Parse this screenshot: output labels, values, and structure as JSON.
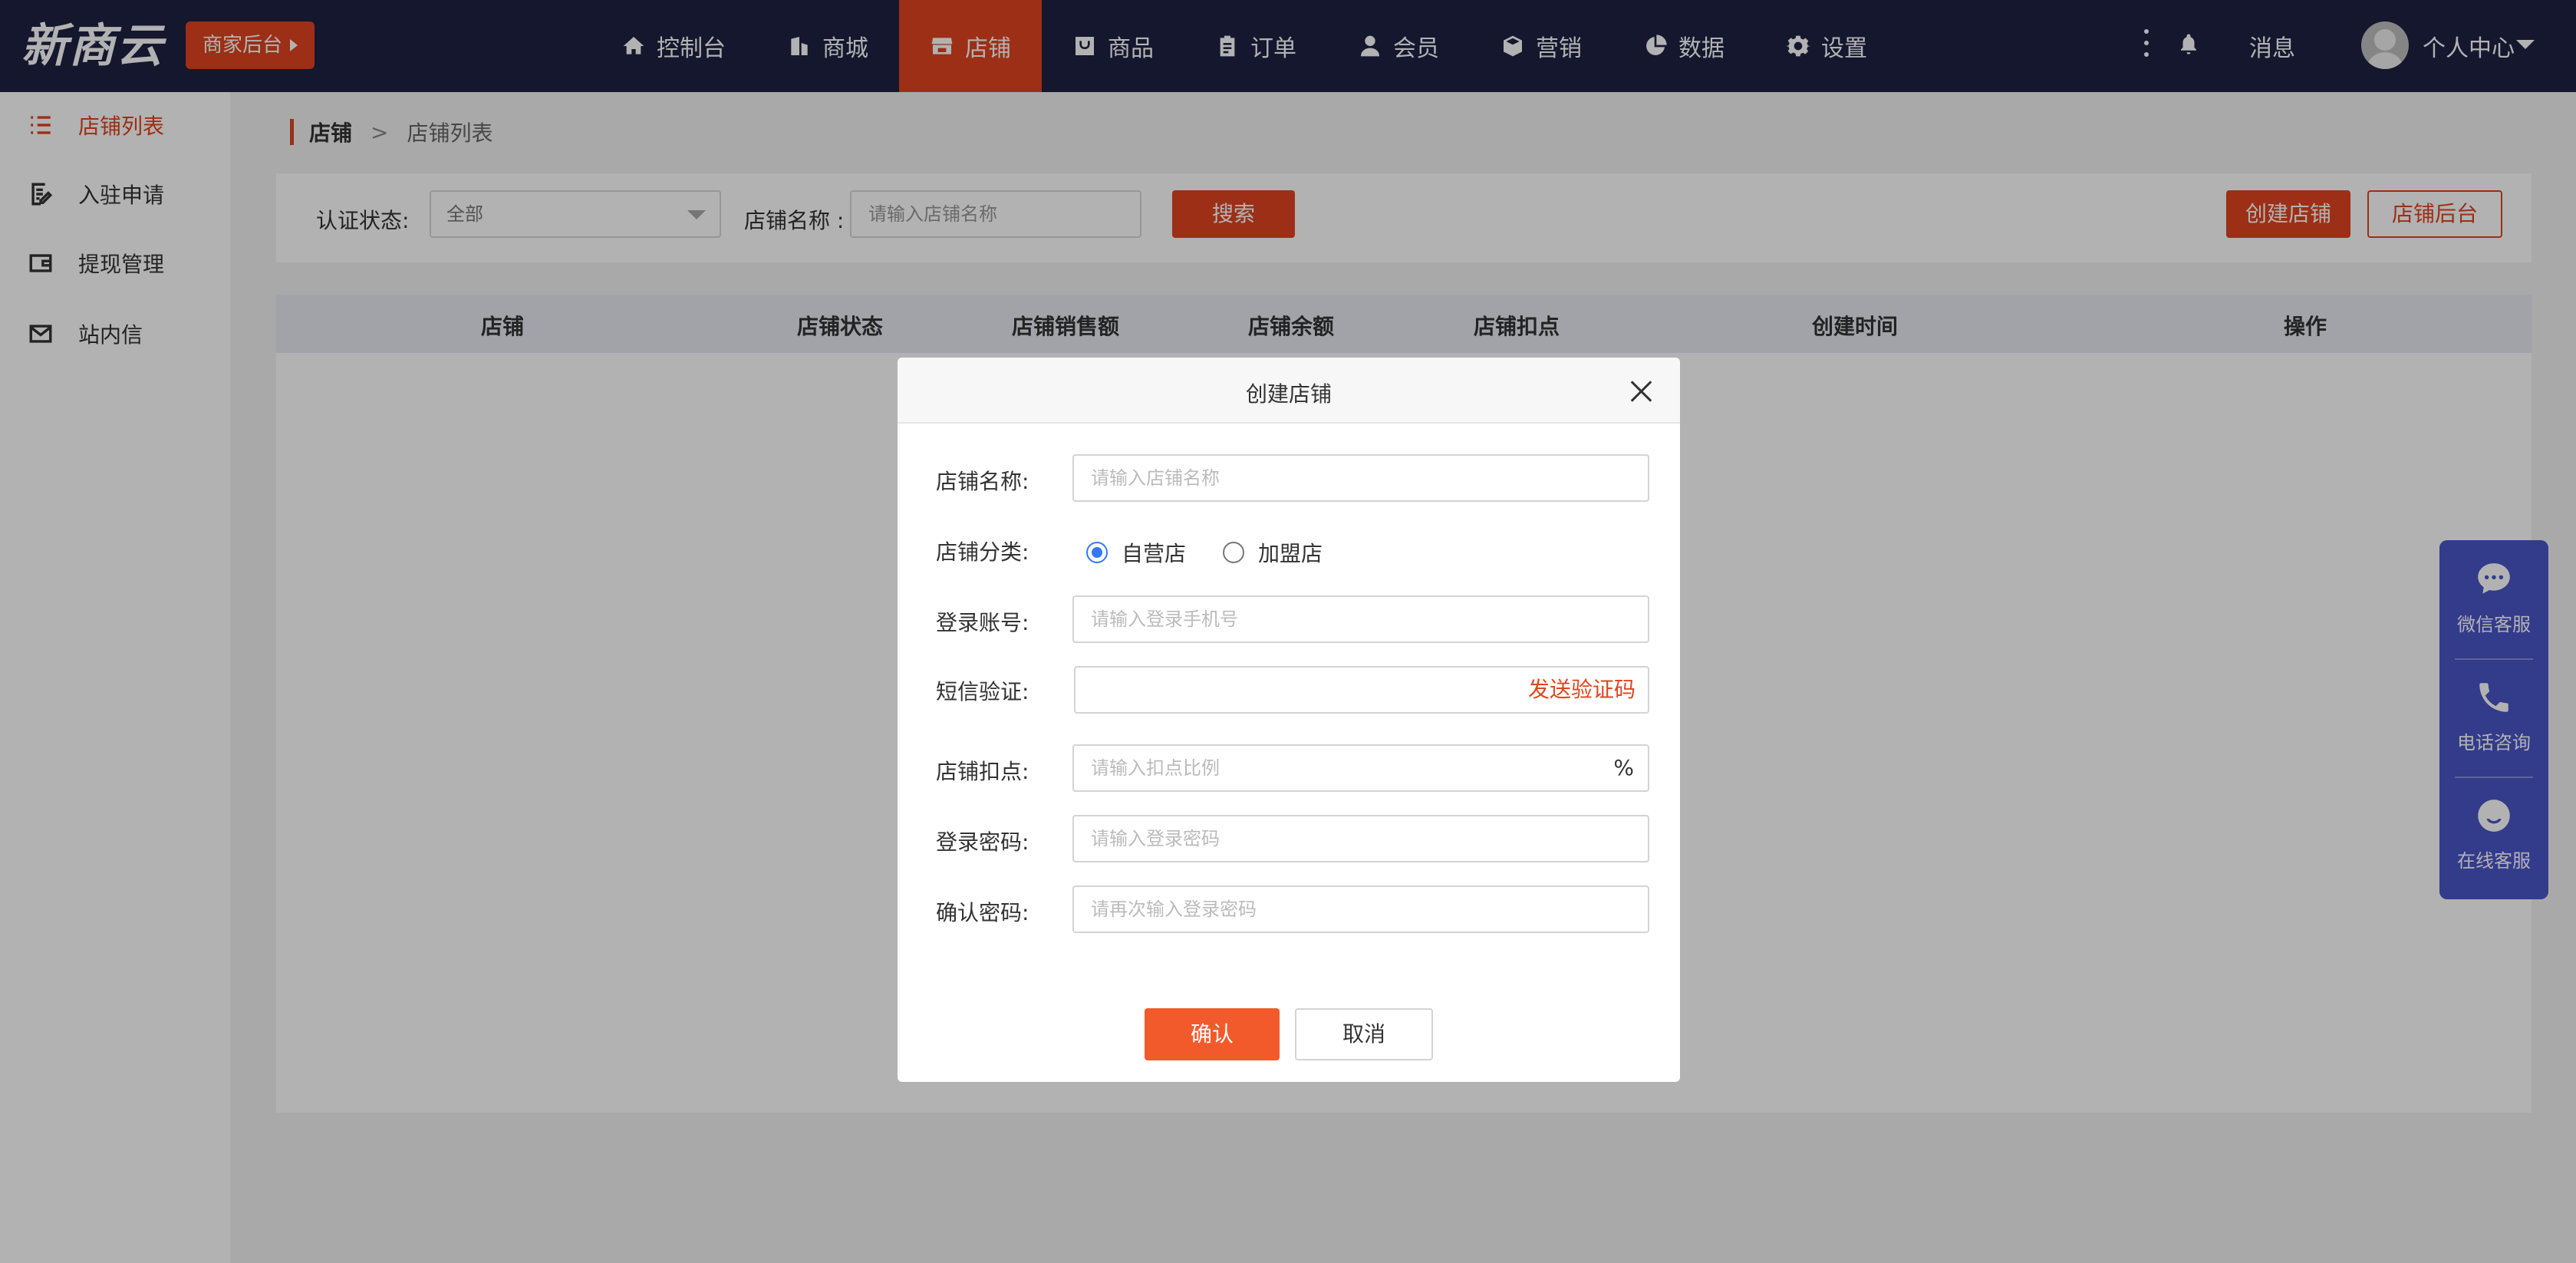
{
  "header": {
    "logo": "新商云",
    "badge": "商家后台",
    "nav": [
      {
        "label": "控制台",
        "icon": "home-icon"
      },
      {
        "label": "商城",
        "icon": "building-icon"
      },
      {
        "label": "店铺",
        "icon": "store-icon",
        "active": true
      },
      {
        "label": "商品",
        "icon": "product-icon"
      },
      {
        "label": "订单",
        "icon": "clipboard-icon"
      },
      {
        "label": "会员",
        "icon": "user-icon"
      },
      {
        "label": "营销",
        "icon": "box-icon"
      },
      {
        "label": "数据",
        "icon": "pie-chart-icon"
      },
      {
        "label": "设置",
        "icon": "gear-icon"
      }
    ],
    "messages": "消息",
    "user": "个人中心"
  },
  "sidebar": {
    "items": [
      {
        "label": "店铺列表",
        "icon": "list-icon",
        "active": true
      },
      {
        "label": "入驻申请",
        "icon": "edit-doc-icon"
      },
      {
        "label": "提现管理",
        "icon": "wallet-icon"
      },
      {
        "label": "站内信",
        "icon": "mail-icon"
      }
    ]
  },
  "breadcrumb": {
    "root": "店铺",
    "separator": ">",
    "current": "店铺列表"
  },
  "filter": {
    "status_label": "认证状态:",
    "status_value": "全部",
    "name_label": "店铺名称 :",
    "name_placeholder": "请输入店铺名称",
    "search": "搜索",
    "create": "创建店铺",
    "admin": "店铺后台"
  },
  "table": {
    "columns": [
      "店铺",
      "店铺状态",
      "店铺销售额",
      "店铺余额",
      "店铺扣点",
      "创建时间",
      "操作"
    ]
  },
  "service": {
    "wechat": "微信客服",
    "phone": "电话咨询",
    "online": "在线客服"
  },
  "modal": {
    "title": "创建店铺",
    "shop_name_label": "店铺名称:",
    "shop_name_placeholder": "请输入店铺名称",
    "category_label": "店铺分类:",
    "category_options": [
      "自营店",
      "加盟店"
    ],
    "category_selected": "自营店",
    "account_label": "登录账号:",
    "account_placeholder": "请输入登录手机号",
    "sms_label": "短信验证:",
    "sms_button": "发送验证码",
    "commission_label": "店铺扣点:",
    "commission_placeholder": "请输入扣点比例",
    "commission_suffix": "%",
    "password_label": "登录密码:",
    "password_placeholder": "请输入登录密码",
    "confirm_label": "确认密码:",
    "confirm_placeholder": "请再次输入登录密码",
    "ok": "确认",
    "cancel": "取消"
  },
  "colors": {
    "accent": "#e0441f",
    "topbar": "#1e2243",
    "service": "#4a55c8",
    "radio": "#3478f6"
  }
}
